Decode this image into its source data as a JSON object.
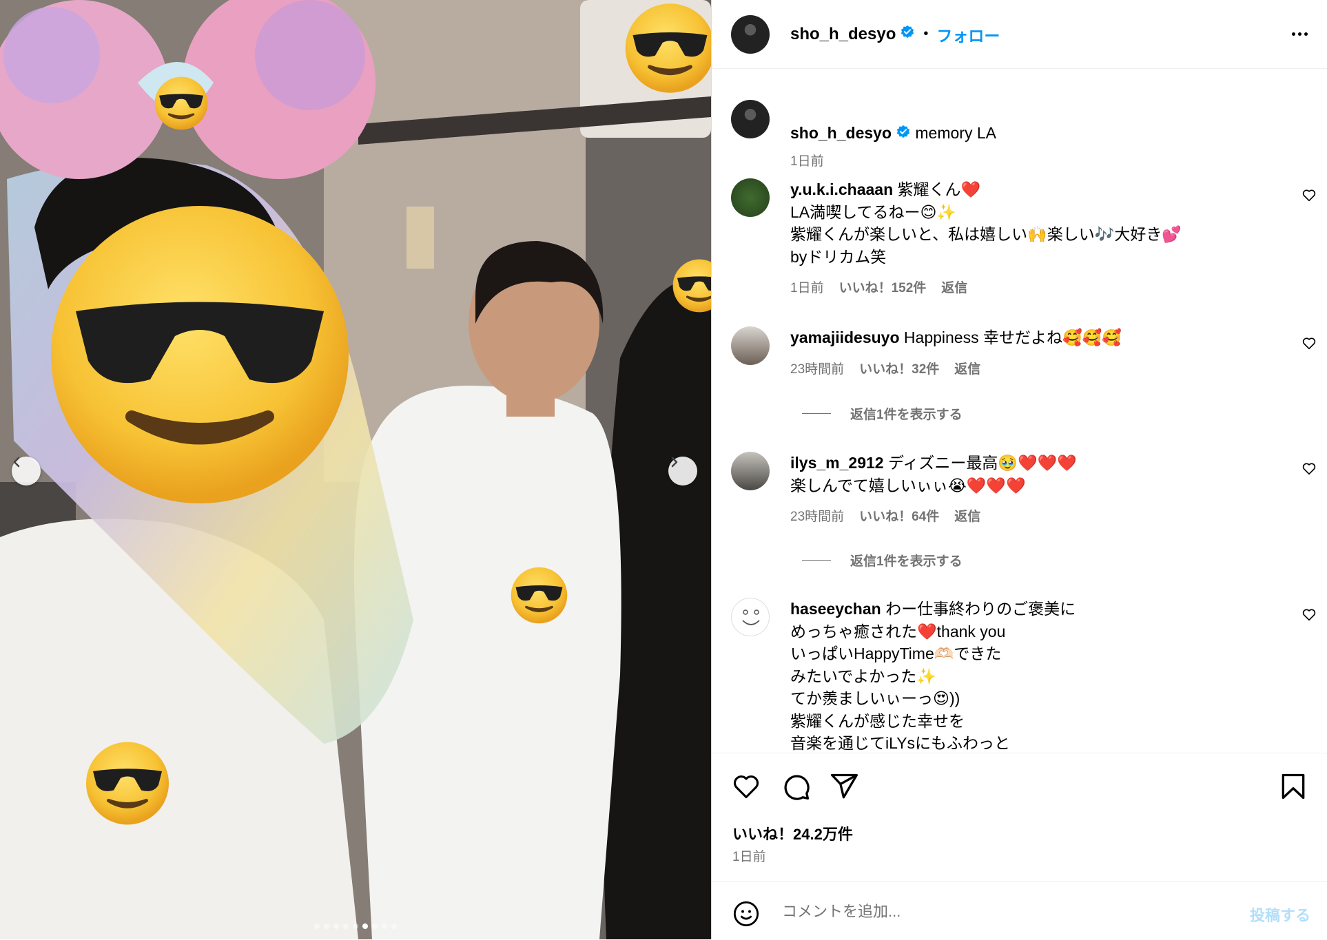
{
  "header": {
    "username": "sho_h_desyo",
    "separator": "•",
    "follow_label": "フォロー"
  },
  "caption": {
    "username": "sho_h_desyo",
    "text": "memory LA",
    "time": "1日前"
  },
  "comments": [
    {
      "username": "y.u.k.i.chaaan",
      "text": "紫耀くん❤️\nLA満喫してるねー😊✨\n紫耀くんが楽しいと、私は嬉しい🙌楽しい🎶大好き💕\nbyドリカム笑",
      "time": "1日前",
      "likes": "いいね！152件",
      "reply": "返信"
    },
    {
      "username": "yamajiidesuyo",
      "text": "Happiness 幸せだよね🥰🥰🥰",
      "time": "23時間前",
      "likes": "いいね！32件",
      "reply": "返信",
      "view_replies": "返信1件を表示する"
    },
    {
      "username": "ilys_m_2912",
      "text": "ディズニー最高🥹❤️❤️❤️\n楽しんでて嬉しいぃぃ😭❤️❤️❤️",
      "time": "23時間前",
      "likes": "いいね！64件",
      "reply": "返信",
      "view_replies": "返信1件を表示する"
    },
    {
      "username": "haseeychan",
      "text": "わー仕事終わりのご褒美に\nめっちゃ癒された❤️thank you\nいっぱいHappyTime🫶🏻できた\nみたいでよかった✨\nてか羨ましいぃーっ😍))\n紫耀くんが感じた幸せを\n音楽を通じてiLYsにもふわっと"
    }
  ],
  "footer": {
    "likes": "いいね！24.2万件",
    "time": "1日前",
    "comment_placeholder": "コメントを追加...",
    "post_label": "投稿する"
  },
  "carousel": {
    "slide_count": 9,
    "active_index": 5
  },
  "colors": {
    "accent": "#0095f6",
    "verified": "#0095f6",
    "post_disabled": "#b2dffc",
    "muted": "#737373"
  },
  "icons": [
    "verified-badge-icon",
    "more-options-icon",
    "heart-icon",
    "comment-icon",
    "share-icon",
    "bookmark-icon",
    "emoji-icon",
    "chevron-left-icon",
    "chevron-right-icon"
  ]
}
